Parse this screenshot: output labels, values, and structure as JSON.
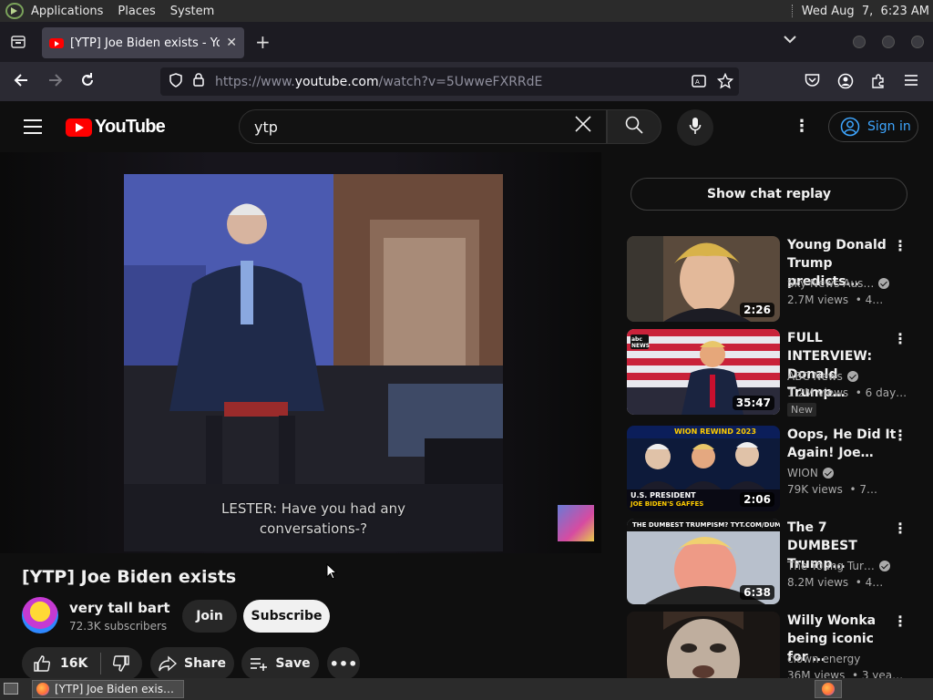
{
  "topbar": {
    "menus": [
      "Applications",
      "Places",
      "System"
    ],
    "clock": "Wed Aug  7,  6:23 AM"
  },
  "browser": {
    "tab_title": "[YTP] Joe Biden exists - YouTube",
    "url_prefix": "https://www.",
    "url_host": "youtube.com",
    "url_path": "/watch?v=5UwweFXRRdE"
  },
  "youtube": {
    "logo_text": "YouTube",
    "search_value": "ytp",
    "signin_label": "Sign in",
    "video": {
      "caption_line1": "LESTER: Have you had any",
      "caption_line2": "conversations-?",
      "title": "[YTP] Joe Biden exists"
    },
    "channel": {
      "name": "very tall bart",
      "subscribers": "72.3K subscribers",
      "join_label": "Join",
      "subscribe_label": "Subscribe"
    },
    "actions": {
      "likes": "16K",
      "share_label": "Share",
      "save_label": "Save"
    },
    "chat_replay_label": "Show chat replay",
    "recommendations": [
      {
        "title": "Young Donald Trump predicts…",
        "channel": "Sky News Aus…",
        "meta": "2.7M views  • 4…",
        "duration": "2:26",
        "badge": ""
      },
      {
        "title": "FULL INTERVIEW: Donald Trump…",
        "channel": "ABC News",
        "meta": "1.2M views  • 6 day…",
        "duration": "35:47",
        "badge": "New"
      },
      {
        "title": "Oops, He Did It Again! Joe…",
        "channel": "WION",
        "meta": "79K views  • 7…",
        "duration": "2:06",
        "badge": ""
      },
      {
        "title": "The 7 DUMBEST Trump…",
        "channel": "The Young Tur…",
        "meta": "8.2M views  • 4…",
        "duration": "6:38",
        "badge": ""
      },
      {
        "title": "Willy Wonka being iconic for …",
        "channel": "clown energy",
        "meta": "36M views  • 3 yea…",
        "duration": "",
        "badge": ""
      }
    ],
    "thumb_texts": {
      "wion_banner": "WION REWIND 2023",
      "wion_caption1": "U.S. PRESIDENT",
      "wion_caption2": "JOE BIDEN'S GAFFES",
      "tyt_banner": "THE DUMBEST TRUMPISM? TYT.COM/DUMB",
      "abc_logo": "abc NEWS"
    }
  },
  "taskbar": {
    "window_label": "[YTP] Joe Biden exis…"
  },
  "colors": {
    "accent_blue": "#3ea6ff",
    "yt_red": "#ff0000",
    "page_bg": "#0f0f0f"
  }
}
